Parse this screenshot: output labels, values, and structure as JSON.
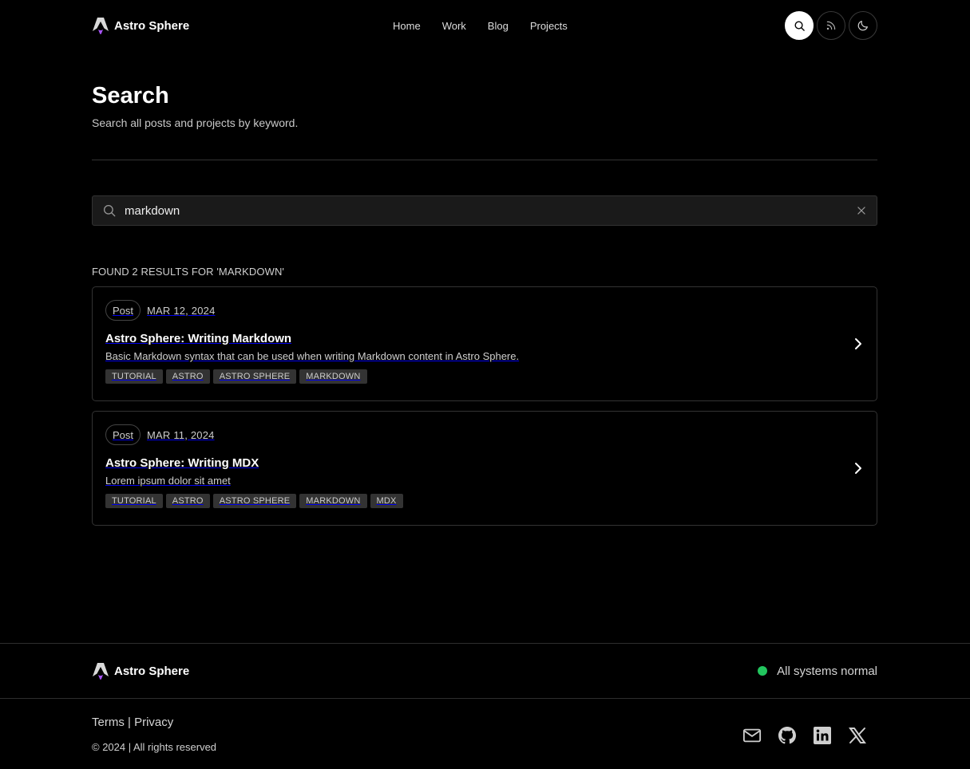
{
  "brand": {
    "name": "Astro Sphere"
  },
  "nav": {
    "items": [
      "Home",
      "Work",
      "Blog",
      "Projects"
    ]
  },
  "header_buttons": {
    "search": "search-icon",
    "rss": "rss-icon",
    "theme": "moon-icon"
  },
  "page": {
    "title": "Search",
    "subtitle": "Search all posts and projects by keyword."
  },
  "search": {
    "value": "markdown",
    "placeholder": ""
  },
  "results": {
    "label": "FOUND 2 RESULTS FOR 'MARKDOWN'",
    "items": [
      {
        "type": "Post",
        "date": "MAR 12, 2024",
        "title": "Astro Sphere: Writing Markdown",
        "description": "Basic Markdown syntax that can be used when writing Markdown content in Astro Sphere.",
        "tags": [
          "TUTORIAL",
          "ASTRO",
          "ASTRO SPHERE",
          "MARKDOWN"
        ]
      },
      {
        "type": "Post",
        "date": "MAR 11, 2024",
        "title": "Astro Sphere: Writing MDX",
        "description": "Lorem ipsum dolor sit amet",
        "tags": [
          "TUTORIAL",
          "ASTRO",
          "ASTRO SPHERE",
          "MARKDOWN",
          "MDX"
        ]
      }
    ]
  },
  "footer": {
    "brand": "Astro Sphere",
    "status": "All systems normal",
    "status_color": "#22c55e",
    "links": {
      "terms": "Terms",
      "separator": "|",
      "privacy": "Privacy"
    },
    "copyright": "© 2024 | All rights reserved",
    "socials": [
      "mail-icon",
      "github-icon",
      "linkedin-icon",
      "x-icon"
    ]
  },
  "colors": {
    "background": "#000000",
    "accent": "#a855f7",
    "card_border": "#333333"
  }
}
